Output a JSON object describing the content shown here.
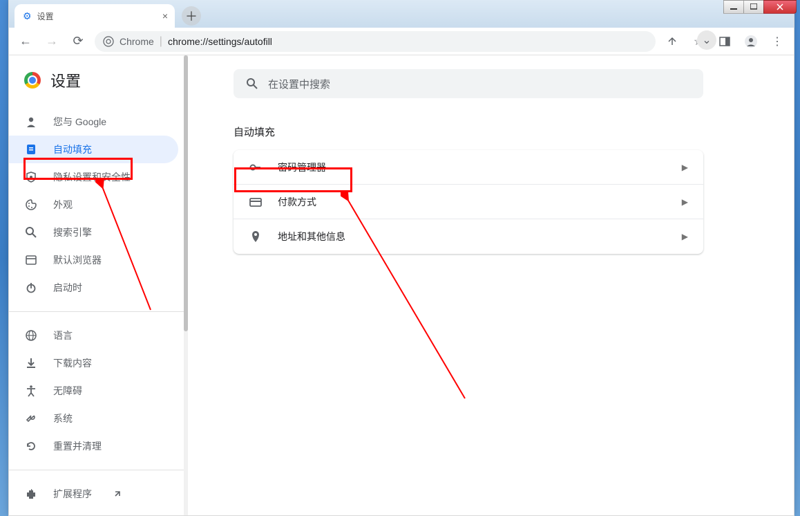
{
  "window": {
    "tab_title": "设置",
    "url_prefix": "Chrome",
    "url_path": "chrome://settings/autofill"
  },
  "sidebar": {
    "title": "设置",
    "items": [
      {
        "label": "您与 Google",
        "icon": "person-icon"
      },
      {
        "label": "自动填充",
        "icon": "form-icon"
      },
      {
        "label": "隐私设置和安全性",
        "icon": "shield-icon"
      },
      {
        "label": "外观",
        "icon": "palette-icon"
      },
      {
        "label": "搜索引擎",
        "icon": "search-icon"
      },
      {
        "label": "默认浏览器",
        "icon": "browser-icon"
      },
      {
        "label": "启动时",
        "icon": "power-icon"
      }
    ],
    "items2": [
      {
        "label": "语言",
        "icon": "globe-icon"
      },
      {
        "label": "下载内容",
        "icon": "download-icon"
      },
      {
        "label": "无障碍",
        "icon": "accessibility-icon"
      },
      {
        "label": "系统",
        "icon": "wrench-icon"
      },
      {
        "label": "重置并清理",
        "icon": "restore-icon"
      }
    ],
    "items3": [
      {
        "label": "扩展程序",
        "icon": "extension-icon"
      }
    ]
  },
  "main": {
    "search_placeholder": "在设置中搜索",
    "section_title": "自动填充",
    "rows": [
      {
        "label": "密码管理器",
        "icon": "key-icon"
      },
      {
        "label": "付款方式",
        "icon": "card-icon"
      },
      {
        "label": "地址和其他信息",
        "icon": "location-icon"
      }
    ]
  }
}
